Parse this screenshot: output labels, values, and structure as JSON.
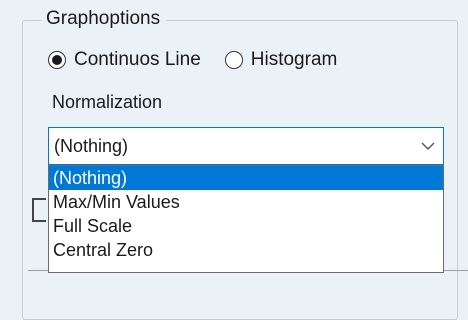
{
  "group": {
    "title": "Graphoptions"
  },
  "graph_type": {
    "options": [
      {
        "label": "Continuos Line",
        "checked": true
      },
      {
        "label": "Histogram",
        "checked": false
      }
    ]
  },
  "normalization": {
    "label": "Normalization",
    "selected": "(Nothing)",
    "options": [
      "(Nothing)",
      "Max/Min Values",
      "Full Scale",
      "Central Zero"
    ]
  },
  "colors": {
    "accent": "#0078d7",
    "background": "#eaf2f8"
  },
  "icons": {
    "combo_arrow": "chevron-down-icon"
  }
}
